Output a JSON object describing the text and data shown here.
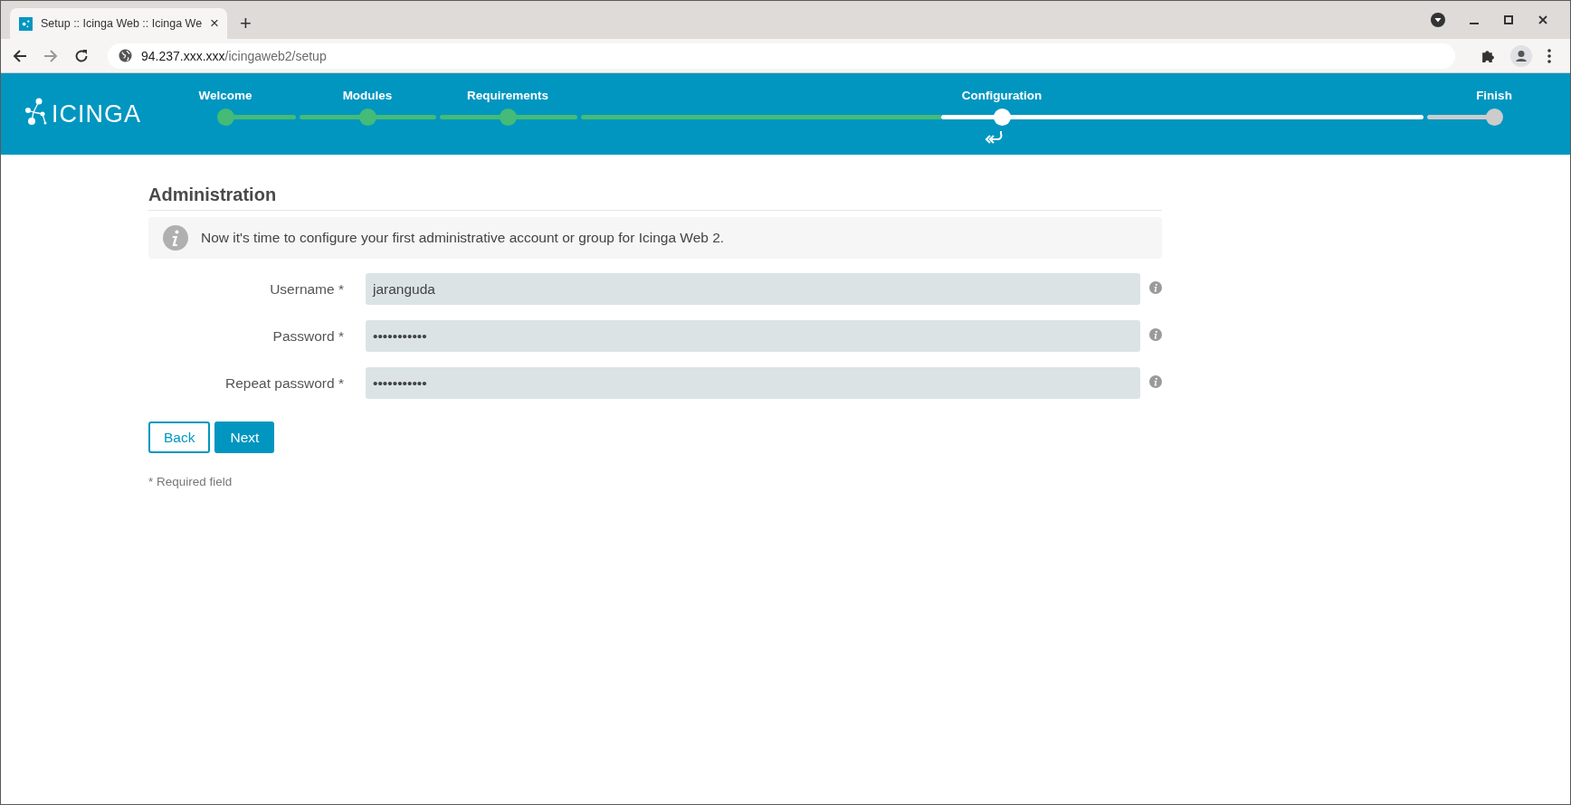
{
  "browser": {
    "tab": {
      "title": "Setup :: Icinga Web :: Icinga We",
      "close": "×"
    },
    "new_tab": "+",
    "address": {
      "host": "94.237.xxx.xxx",
      "path": "/icingaweb2/setup"
    }
  },
  "header": {
    "logo": "ICINGA",
    "steps": [
      {
        "label": "Welcome",
        "done": true,
        "selected": false
      },
      {
        "label": "Modules",
        "done": true,
        "selected": false
      },
      {
        "label": "Requirements",
        "done": true,
        "selected": false
      },
      {
        "label": "Configuration",
        "done": false,
        "selected": true
      },
      {
        "label": "Finish",
        "done": false,
        "selected": false
      }
    ]
  },
  "form": {
    "title": "Administration",
    "info": "Now it's time to configure your first administrative account or group for Icinga Web 2.",
    "fields": [
      {
        "label": "Username *",
        "value": "jaranguda"
      },
      {
        "label": "Password *",
        "value": "•••••••••••"
      },
      {
        "label": "Repeat password *",
        "value": "•••••••••••"
      }
    ],
    "buttons": [
      {
        "label": "Back",
        "kind": "secondary"
      },
      {
        "label": "Next",
        "kind": "primary"
      }
    ],
    "footnote": "* Required field"
  }
}
